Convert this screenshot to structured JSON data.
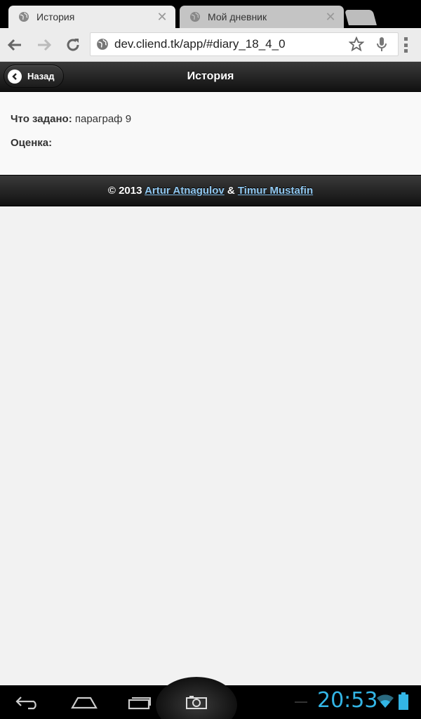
{
  "browser": {
    "tabs": [
      {
        "title": "История",
        "icon": "globe-icon",
        "active": true
      },
      {
        "title": "Мой дневник",
        "icon": "globe-icon",
        "active": false
      }
    ],
    "close_glyph": "✕",
    "url": "dev.cliend.tk/app/#diary_18_4_0"
  },
  "app": {
    "back_label": "Назад",
    "title": "История"
  },
  "content": {
    "assigned_label": "Что задано:",
    "assigned_value": "параграф 9",
    "grade_label": "Оценка:",
    "grade_value": ""
  },
  "footer": {
    "prefix": "© 2013",
    "author1": "Artur Atnagulov",
    "sep": "&",
    "author2": "Timur Mustafin"
  },
  "system": {
    "time": "20:53",
    "accent": "#33b5e5"
  }
}
